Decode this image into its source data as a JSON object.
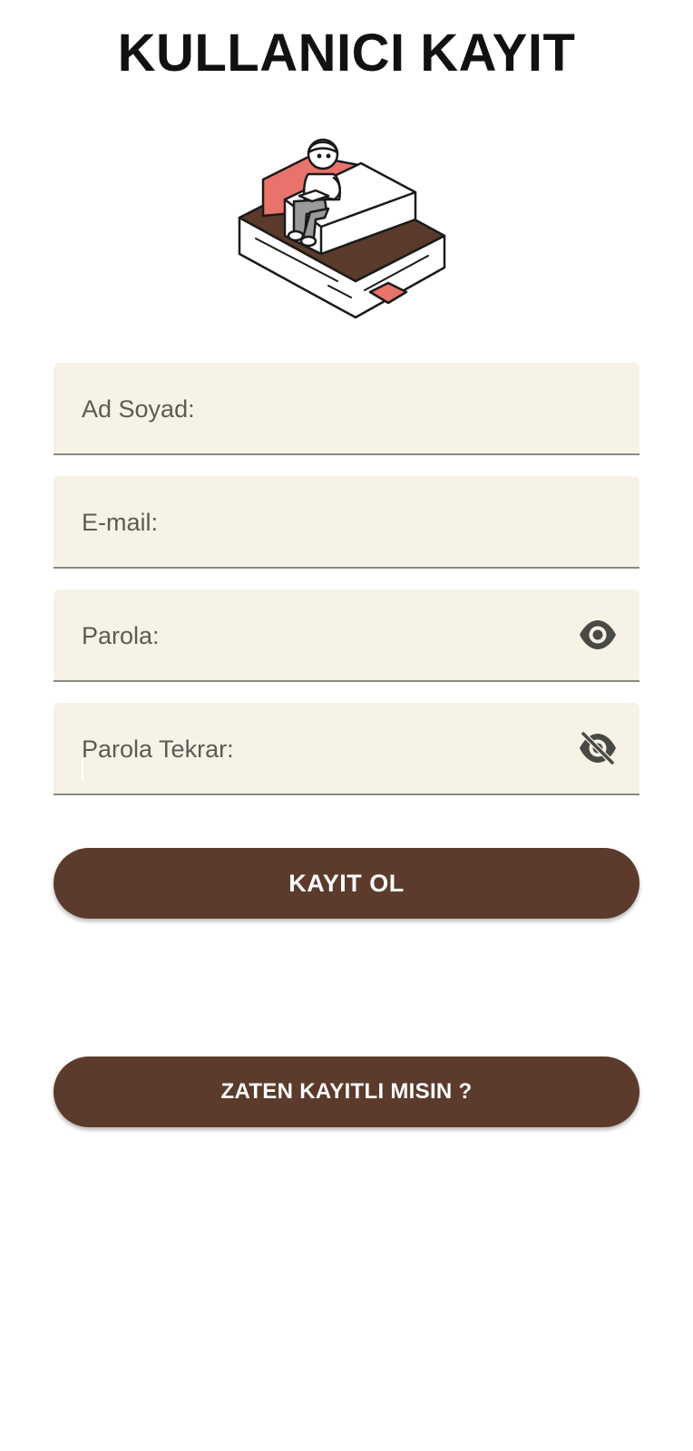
{
  "header": {
    "title": "KULLANICI KAYIT"
  },
  "illustration": {
    "icon": "person-reading-on-book-illustration"
  },
  "form": {
    "fields": [
      {
        "label": "Ad Soyad:",
        "value": ""
      },
      {
        "label": "E-mail:",
        "value": ""
      },
      {
        "label": "Parola:",
        "value": "",
        "toggle_icon": "eye-icon"
      },
      {
        "label": "Parola Tekrar:",
        "value": "",
        "toggle_icon": "eye-off-icon"
      }
    ]
  },
  "actions": {
    "register_label": "KAYIT OL",
    "login_label": "ZATEN KAYITLI MISIN ?"
  },
  "colors": {
    "primary_brown": "#5c3b2c",
    "field_background": "#f6f3e6",
    "accent_red": "#e8736a"
  }
}
